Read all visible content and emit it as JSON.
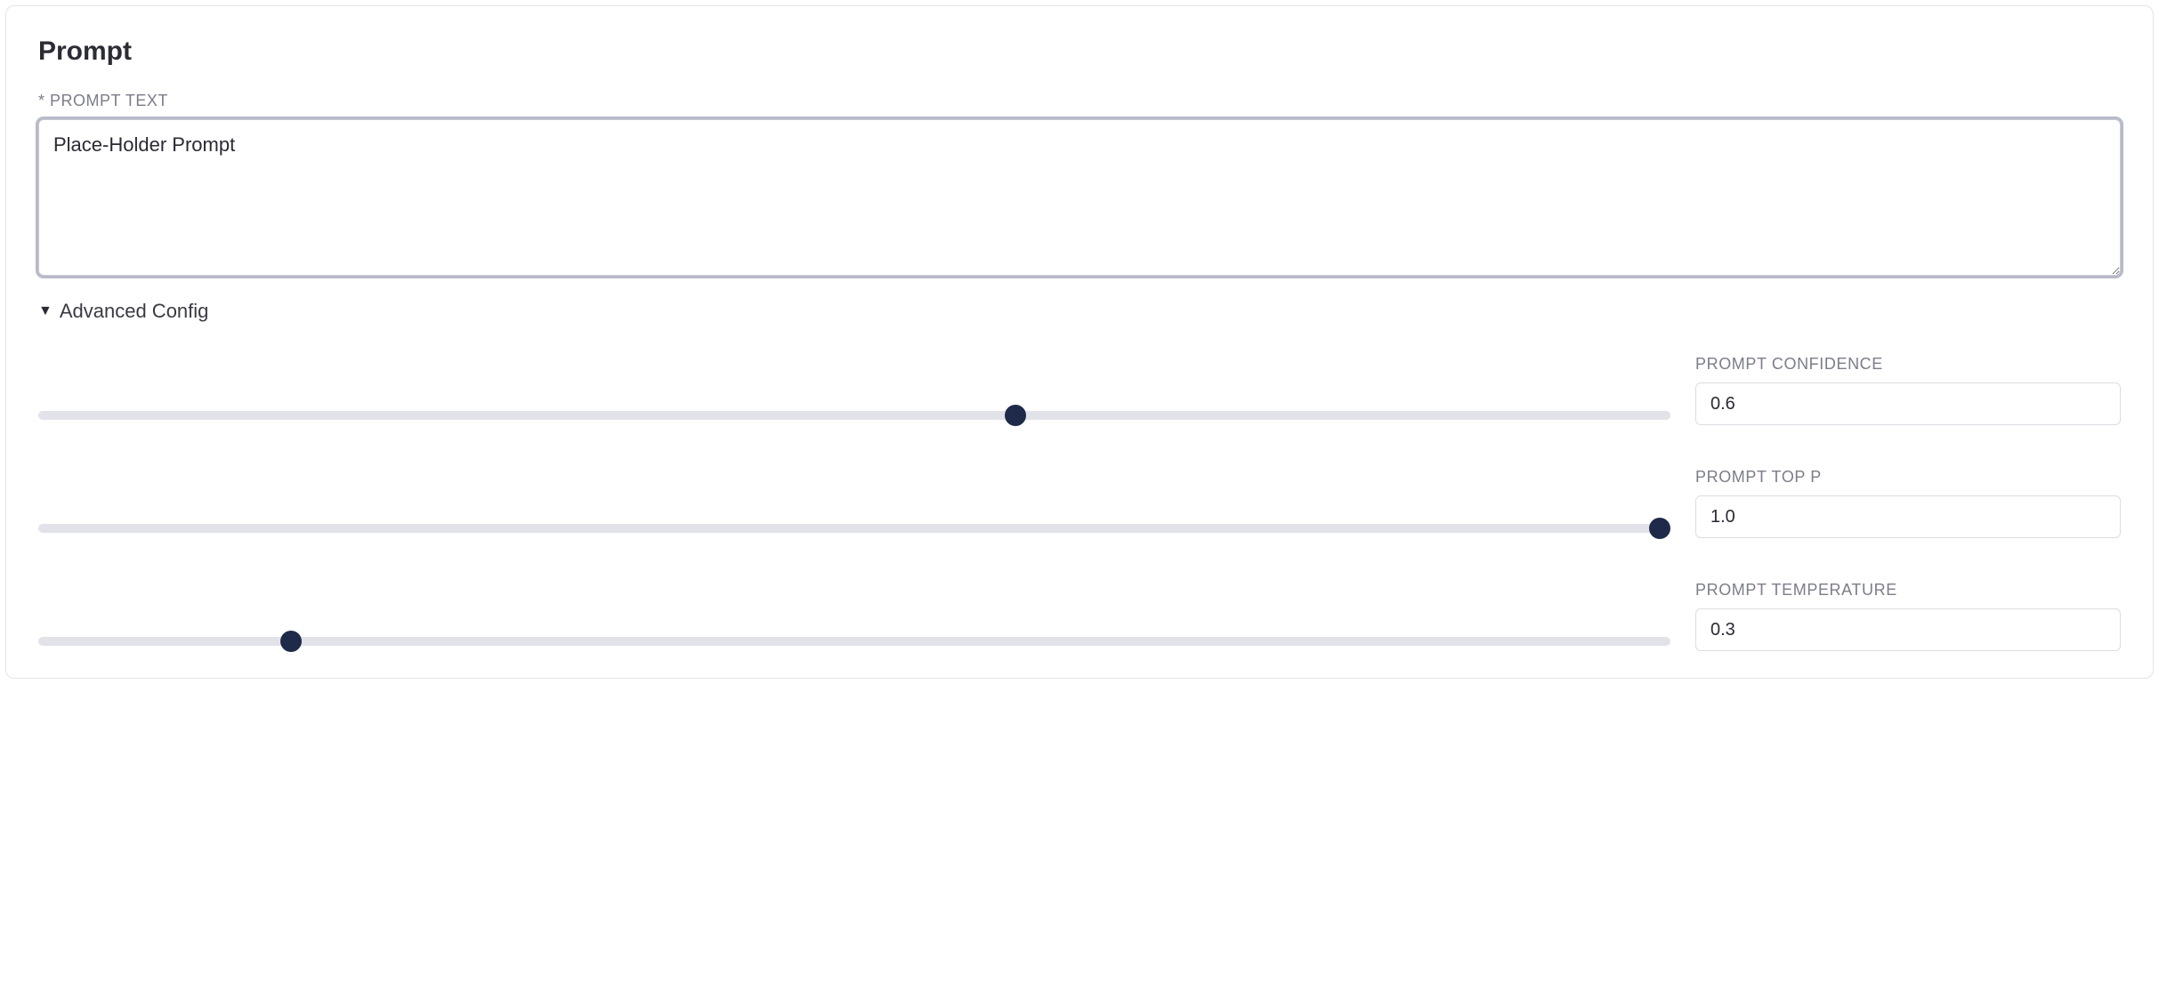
{
  "panel": {
    "title": "Prompt",
    "prompt_text_label": "* PROMPT TEXT",
    "prompt_text_value": "Place-Holder Prompt",
    "advanced_label": "Advanced Config",
    "sliders": {
      "confidence": {
        "label": "PROMPT CONFIDENCE",
        "value": "0.6",
        "slider_percent": 60
      },
      "top_p": {
        "label": "PROMPT TOP P",
        "value": "1.0",
        "slider_percent": 100
      },
      "temperature": {
        "label": "PROMPT TEMPERATURE",
        "value": "0.3",
        "slider_percent": 15
      }
    }
  }
}
